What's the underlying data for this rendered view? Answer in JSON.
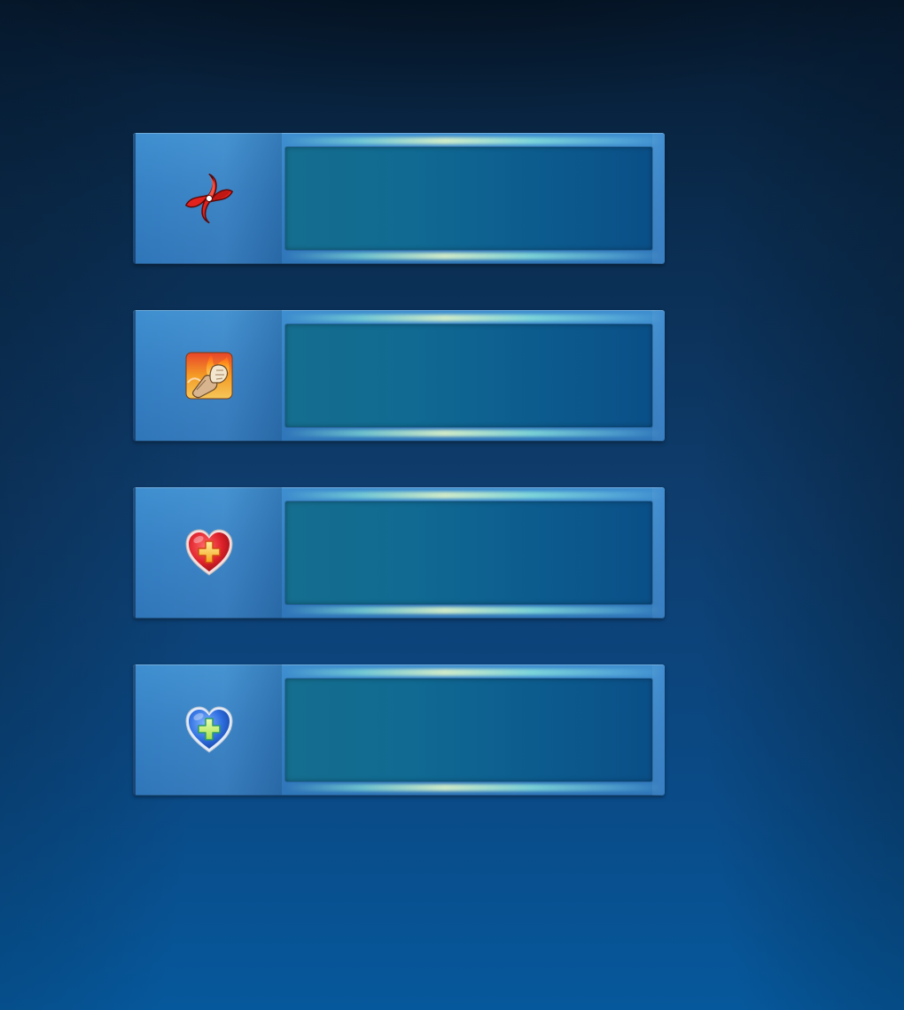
{
  "panels": [
    {
      "id": "shuriken",
      "icon": "shuriken-icon",
      "accent": "#d81e1e"
    },
    {
      "id": "flaming-fist",
      "icon": "flaming-fist-icon",
      "accent": "#f29a1f"
    },
    {
      "id": "health",
      "icon": "red-heart-plus-icon",
      "accent": "#cc1f2a"
    },
    {
      "id": "shield",
      "icon": "blue-heart-plus-icon",
      "accent": "#2a6fd6"
    }
  ],
  "colors": {
    "background_top": "#061a30",
    "background_bottom": "#06589c",
    "panel": "#3681c4",
    "slot": "#106a92",
    "glow": "#d7f0c8"
  }
}
